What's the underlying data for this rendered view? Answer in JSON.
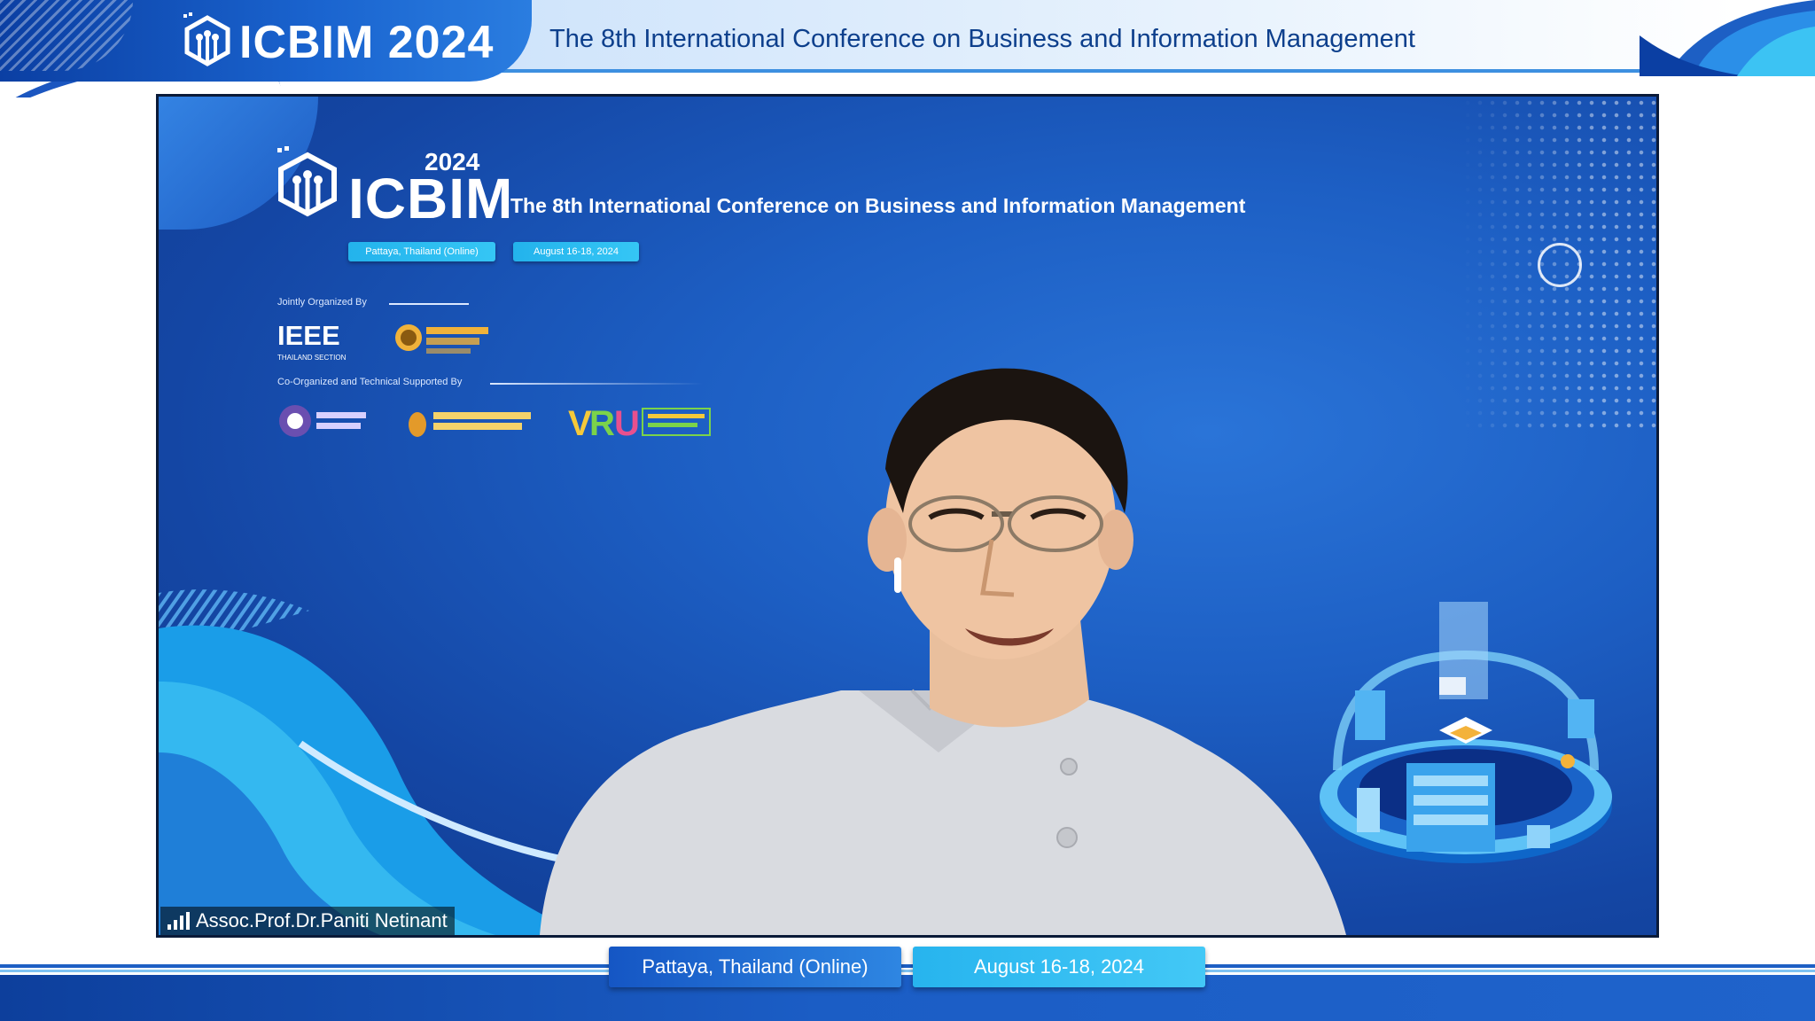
{
  "header": {
    "logo_text": "ICBIM 2024",
    "title": "The 8th International Conference on Business and Information Management"
  },
  "video": {
    "inner_logo_year": "2024",
    "inner_logo_text": "ICBIM",
    "inner_title": "The 8th International Conference on Business and Information Management",
    "inner_location": "Pattaya, Thailand (Online)",
    "inner_date": "August 16-18, 2024",
    "jointly_label": "Jointly Organized By",
    "co_label": "Co-Organized and Technical Supported By",
    "ieee_logo_text": "IEEE",
    "ieee_sub": "THAILAND SECTION",
    "speaker_name": "Assoc.Prof.Dr.Paniti Netinant"
  },
  "footer": {
    "location": "Pattaya, Thailand (Online)",
    "date": "August 16-18, 2024"
  },
  "colors": {
    "brand_dark": "#0b3fa3",
    "brand_blue": "#1d5fc4",
    "accent_cyan": "#35c6f5",
    "header_text": "#0d3f8c"
  }
}
